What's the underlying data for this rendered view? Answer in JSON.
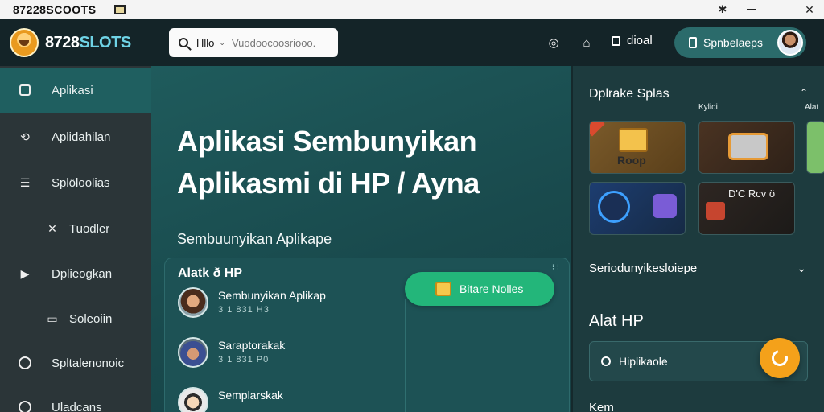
{
  "window": {
    "title": "87228SCOOTS"
  },
  "header": {
    "logo_number": "8728",
    "logo_word": "SLOTS",
    "search_value": "Hllo",
    "search_placeholder": "Vuodoocoosriooo.",
    "user_label": "dioal",
    "pill_label": "Spnbelaeps"
  },
  "sidebar": {
    "items": [
      {
        "label": "Aplikasi"
      },
      {
        "label": "Aplidahilan"
      },
      {
        "label": "Splöloolias"
      },
      {
        "label": "Tuodler"
      },
      {
        "label": "Dplieogkan"
      },
      {
        "label": "Soleoiin"
      },
      {
        "label": "Spltalenonoic"
      },
      {
        "label": "Uladcans"
      }
    ]
  },
  "main": {
    "hero_line1": "Aplikasi Sembunyikan",
    "hero_line2": "Aplikasmi di HP / Ayna",
    "subtitle": "Sembuunyikan Aplikape",
    "panel": {
      "title": "Alatk ð HP",
      "dots": "⁝ ⁝",
      "button_label": "Bitare Nolles",
      "rows": [
        {
          "name": "Sembunyikan Aplikap",
          "meta": "3 1 831 H3"
        },
        {
          "name": "Saraptorakak",
          "meta": "3 1 831 P0"
        },
        {
          "name": "Semplarskak",
          "meta": ""
        }
      ]
    }
  },
  "right": {
    "title": "Dplrake Splas",
    "label_a": "Kylidi",
    "label_b": "Alat",
    "tiles": [
      {
        "text": "Roop"
      },
      {
        "text": ""
      },
      {
        "text": ""
      },
      {
        "text": "D'C  Rcv ö"
      },
      {
        "text": ""
      }
    ],
    "section_label": "Seriodunyikesloiepe",
    "heading": "Alat HP",
    "field_label": "Hiplikaole",
    "footer": "Kem"
  },
  "colors": {
    "accent_teal": "#1f5f60",
    "accent_green": "#23b67a",
    "accent_orange": "#f4a11a"
  }
}
